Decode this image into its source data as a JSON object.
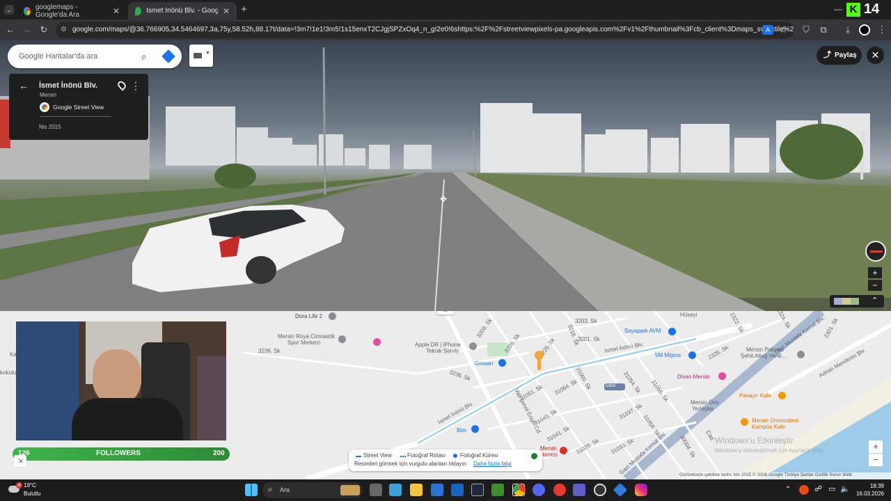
{
  "browser": {
    "tabs": [
      {
        "label": "googlemaps - Google'da Ara",
        "active": false
      },
      {
        "label": "İsmet İnönü Blv. - Google Harit",
        "active": true
      }
    ],
    "new_tab": "+",
    "url": "google.com/maps/@36.766905,34.5464697,3a,75y,58.52h,88.17t/data=!3m7!1e1!3m5!1s15enxT2CJgjSPZxOq4_n_gI2e0!6shttps:%2F%2Fstreetviewpixels-pa.googleapis.com%2Fv1%2Fthumbnail%3Fcb_client%3Dmaps_sv.tactile%26w%3D90...",
    "overlay_counter": "14"
  },
  "maps": {
    "search_placeholder": "Google Haritalar'da ara",
    "card": {
      "title": "İsmet İnönü Blv.",
      "subtitle": "Mersin",
      "source": "Google Street View",
      "date": "Nis 2015"
    },
    "share_label": "Paylaş",
    "legend": {
      "street_view": "Street View",
      "photo_route": "Fotoğraf Rotası",
      "photo_sphere": "Fotoğraf Küresi",
      "hint": "Resimleri görmek için vurgulu alanları tıklayın",
      "more": "Daha fazla bilgi"
    },
    "zoom_in": "+",
    "zoom_out": "−",
    "attribution": "Görüntünün çekilme tarihi: Nis 2015   © 2026 Google   Türkiye   Şartlar   Gizlilik   Sorun bildir",
    "watermark_title": "Windows'u Etkinleştir",
    "watermark_sub": "Windows'u etkinleştirmek için Ayarlar'a gidin.",
    "map_labels": {
      "dora": "Dora Life 2",
      "sport": "Mersin Rüya Cimnastik",
      "sport2": "Spor Merkezi",
      "apple": "Apple DR | iPhone",
      "apple2": "Teknik Servis",
      "groseri": "Groseri",
      "sayapark": "Sayapark AVM",
      "migros": "5M Migros",
      "divan": "Divan Mersin",
      "police": "Mersin Polisevi",
      "police2": "Şehit Altuğ Verdi...",
      "panayir": "Panayır Kafe",
      "univ": "Mersin Üniversitesi",
      "univ2": "Kampüs Kafe",
      "bim": "Bim",
      "ismet1": "İsmet İnönü Blv.",
      "ismet2": "İsmet İnönü Blv.",
      "gazi": "Gazi Mustafa Kemal Blv.",
      "adnan": "Adnan Menderes Blv.",
      "vali": "Vali Şenol Engin Cd.",
      "s3236": "3236. Sk",
      "s3236b": "3236. Sk",
      "s3209": "3209. Sk",
      "s3205": "3205. Sk",
      "s3226": "3226. Sk",
      "s3203": "3203. Sk",
      "s3201": "3201. Sk",
      "s3216": "3216. Sk",
      "s31060": "31060. Sk",
      "s31064": "31064. Sk",
      "s31051": "31051. Sk",
      "s31045": "31045. Sk",
      "s31041": "31041. Sk",
      "s31054": "31054. Sk",
      "s31056": "31056. Sk",
      "s31037": "31037. Sk",
      "s31058": "31058. Sk",
      "s31035": "31035. Sk",
      "s31033": "31033. Sk",
      "s30004": "30004. Sk",
      "s2326": "2326. Sk",
      "s2301": "2301. Sk",
      "s2324": "2324. Sk",
      "s2322": "2322. Sk",
      "hospital": "Mersin",
      "hospital2": "Hanesi",
      "d400": "D400",
      "univ_label": "Mersin Ünv.",
      "univ_label2": "Yerleşke",
      "cad": "Cad.",
      "huseyin": "Hüseyi",
      "kokulu": "kokulu",
      "ka": "Ka"
    }
  },
  "stream": {
    "followers_label": "FOLLOWERS",
    "followers_current": "126",
    "followers_goal": "200"
  },
  "taskbar": {
    "weather_temp": "19°C",
    "weather_desc": "Bulutlu",
    "weather_badge": "4",
    "search": "Ara",
    "time": "18:39",
    "date": "16.03.2026"
  }
}
